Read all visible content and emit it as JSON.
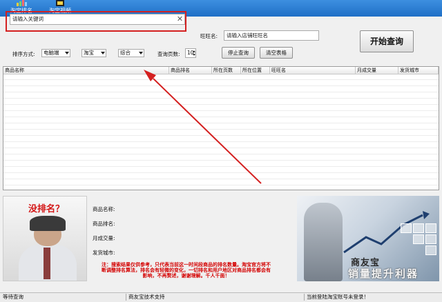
{
  "toolbar": {
    "items": [
      {
        "label": "淘宝排名",
        "icon": "bar-chart-icon"
      },
      {
        "label": "淘宝视频",
        "icon": "video-icon"
      }
    ]
  },
  "form": {
    "keyword_placeholder": "请输入关键词",
    "shop_label": "旺旺名:",
    "shop_placeholder": "请输入店铺旺旺名",
    "sort_label": "排序方式:",
    "sort_device": "电脑端",
    "sort_platform": "淘宝",
    "sort_order": "综合",
    "pages_label": "查询页数:",
    "pages_value": "10",
    "stop_button": "停止查询",
    "clear_button": "清空表格",
    "start_button": "开始查询"
  },
  "grid": {
    "columns": [
      "商品名称",
      "商品排名",
      "所在页数",
      "所在位置",
      "旺旺名",
      "月成交量",
      "发货城市"
    ]
  },
  "details": {
    "labels": [
      "商品名称:",
      "商品排名:",
      "月成交量:",
      "发货城市:"
    ],
    "note": "注：搜索结果仅供参考，只代表当前这一时间段商品的排名数量。淘宝官方将不断调整排名算法，排名会有轻微的变化，一切排名和用户地区对商品排名都会有影响，不再赘述，谢谢理解。千人千面！"
  },
  "ads": {
    "left_title": "没排名？",
    "right_brand": "商友宝",
    "right_slogan": "销量提升利器"
  },
  "status": {
    "left": "等待查询",
    "middle": "商友宝技术支持",
    "right": "当前登陆淘宝账号未登录！"
  },
  "colors": {
    "toolbar": "#2b7fd6",
    "highlight": "#d42020",
    "arrow": "#d42020",
    "note": "#d40000"
  }
}
